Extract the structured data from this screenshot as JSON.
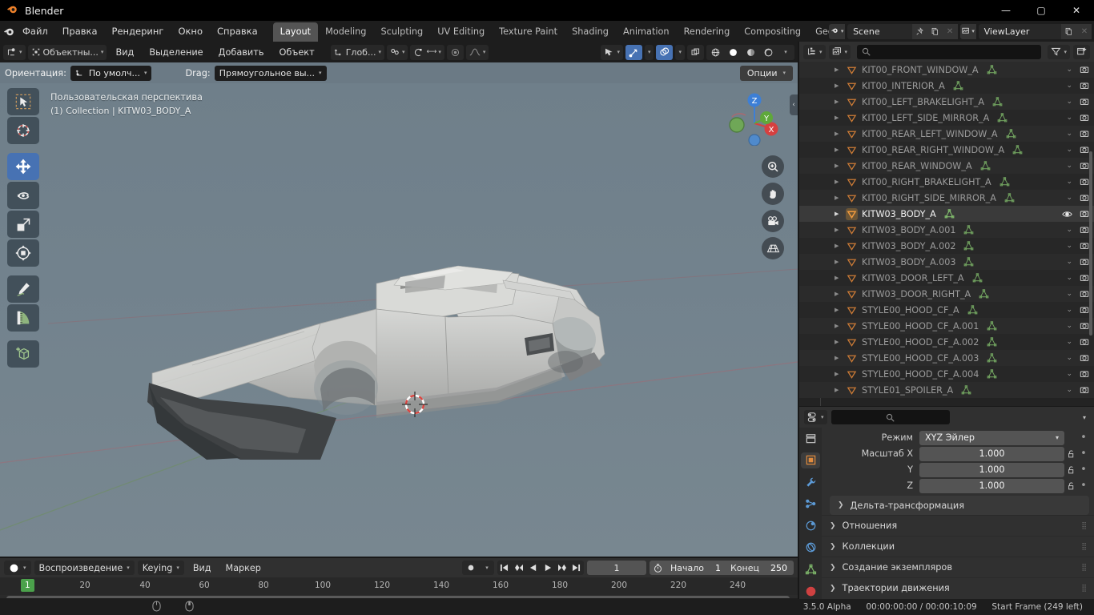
{
  "window": {
    "title": "Blender",
    "minimize": "—",
    "maximize": "▢",
    "close": "✕"
  },
  "topbar": {
    "menus": [
      "Файл",
      "Правка",
      "Рендеринг",
      "Окно",
      "Справка"
    ],
    "workspace_tabs": [
      {
        "label": "Layout",
        "active": true
      },
      {
        "label": "Modeling",
        "active": false
      },
      {
        "label": "Sculpting",
        "active": false
      },
      {
        "label": "UV Editing",
        "active": false
      },
      {
        "label": "Texture Paint",
        "active": false
      },
      {
        "label": "Shading",
        "active": false
      },
      {
        "label": "Animation",
        "active": false
      },
      {
        "label": "Rendering",
        "active": false
      },
      {
        "label": "Compositing",
        "active": false
      },
      {
        "label": "Geo",
        "active": false
      }
    ],
    "scene_name": "Scene",
    "viewlayer_name": "ViewLayer"
  },
  "viewport_header": {
    "mode": "Объектны...",
    "menus": [
      "Вид",
      "Выделение",
      "Добавить",
      "Объект"
    ],
    "transform_orientation_btn": "Глоб...",
    "proportional_label": ""
  },
  "viewport_subheader": {
    "orientation_label": "Ориентация:",
    "orientation_value": "По умолч...",
    "drag_label": "Drag:",
    "drag_value": "Прямоугольное вы...",
    "options_label": "Опции"
  },
  "viewport": {
    "overlay_line1": "Пользовательская перспектива",
    "overlay_line2": "(1) Collection | KITW03_BODY_A",
    "gizmo_axes": {
      "x": "X",
      "y": "Y",
      "z": "Z"
    },
    "tools": [
      {
        "name": "tweak-tool",
        "active": false
      },
      {
        "name": "cursor-tool",
        "active": false
      },
      {
        "name": "move-tool",
        "active": true
      },
      {
        "name": "rotate-tool",
        "active": false
      },
      {
        "name": "scale-tool",
        "active": false
      },
      {
        "name": "transform-tool",
        "active": false
      },
      {
        "name": "annotate-tool",
        "active": false
      },
      {
        "name": "measure-tool",
        "active": false
      },
      {
        "name": "add-cube-tool",
        "active": false
      }
    ],
    "nav_buttons": [
      "zoom-icon",
      "pan-hand-icon",
      "camera-icon",
      "perspective-grid-icon"
    ]
  },
  "outliner": {
    "search_placeholder": "",
    "items": [
      {
        "name": "KIT00_FRONT_WINDOW_A",
        "selected": false
      },
      {
        "name": "KIT00_INTERIOR_A",
        "selected": false
      },
      {
        "name": "KIT00_LEFT_BRAKELIGHT_A",
        "selected": false
      },
      {
        "name": "KIT00_LEFT_SIDE_MIRROR_A",
        "selected": false
      },
      {
        "name": "KIT00_REAR_LEFT_WINDOW_A",
        "selected": false
      },
      {
        "name": "KIT00_REAR_RIGHT_WINDOW_A",
        "selected": false
      },
      {
        "name": "KIT00_REAR_WINDOW_A",
        "selected": false
      },
      {
        "name": "KIT00_RIGHT_BRAKELIGHT_A",
        "selected": false
      },
      {
        "name": "KIT00_RIGHT_SIDE_MIRROR_A",
        "selected": false
      },
      {
        "name": "KITW03_BODY_A",
        "selected": true
      },
      {
        "name": "KITW03_BODY_A.001",
        "selected": false
      },
      {
        "name": "KITW03_BODY_A.002",
        "selected": false
      },
      {
        "name": "KITW03_BODY_A.003",
        "selected": false
      },
      {
        "name": "KITW03_DOOR_LEFT_A",
        "selected": false
      },
      {
        "name": "KITW03_DOOR_RIGHT_A",
        "selected": false
      },
      {
        "name": "STYLE00_HOOD_CF_A",
        "selected": false
      },
      {
        "name": "STYLE00_HOOD_CF_A.001",
        "selected": false
      },
      {
        "name": "STYLE00_HOOD_CF_A.002",
        "selected": false
      },
      {
        "name": "STYLE00_HOOD_CF_A.003",
        "selected": false
      },
      {
        "name": "STYLE00_HOOD_CF_A.004",
        "selected": false
      },
      {
        "name": "STYLE01_SPOILER_A",
        "selected": false
      }
    ]
  },
  "properties": {
    "search_placeholder": "",
    "rows": [
      {
        "label": "Режим",
        "value": "XYZ Эйлер",
        "type": "dropdown"
      },
      {
        "label": "Масштаб X",
        "value": "1.000",
        "type": "number"
      },
      {
        "label": "Y",
        "value": "1.000",
        "type": "number"
      },
      {
        "label": "Z",
        "value": "1.000",
        "type": "number"
      }
    ],
    "panels": [
      {
        "label": "Дельта-трансформация",
        "inset": true
      },
      {
        "label": "Отношения",
        "inset": false
      },
      {
        "label": "Коллекции",
        "inset": false
      },
      {
        "label": "Создание экземпляров",
        "inset": false
      },
      {
        "label": "Траектории движения",
        "inset": false
      }
    ],
    "tabs": [
      {
        "name": "tool-tab",
        "active": false
      },
      {
        "name": "object-tab",
        "active": true
      },
      {
        "name": "modifier-tab",
        "active": false
      },
      {
        "name": "particles-tab",
        "active": false
      },
      {
        "name": "physics-tab",
        "active": false
      },
      {
        "name": "constraint-tab",
        "active": false
      },
      {
        "name": "data-tab",
        "active": false
      },
      {
        "name": "material-tab",
        "active": false
      }
    ]
  },
  "timeline": {
    "menus": [
      "Вид",
      "Маркер"
    ],
    "playback_label": "Воспроизведение",
    "keying_label": "Keying",
    "current_frame": "1",
    "start_label": "Начало",
    "start_value": "1",
    "end_label": "Конец",
    "end_value": "250",
    "playhead_frame": "1",
    "ticks": [
      "20",
      "40",
      "60",
      "80",
      "100",
      "120",
      "140",
      "160",
      "180",
      "200",
      "220",
      "240"
    ]
  },
  "statusbar": {
    "version": "3.5.0 Alpha",
    "time": "00:00:00:00 / 00:00:10:09",
    "frame_info": "Start Frame (249 left)"
  },
  "colors": {
    "accent_blue": "#4772b3",
    "selected_orange": "#e8964a",
    "mesh_green": "#6f9f5e",
    "playhead_green": "#4ba14b",
    "viewport_bg": "#72828d"
  }
}
